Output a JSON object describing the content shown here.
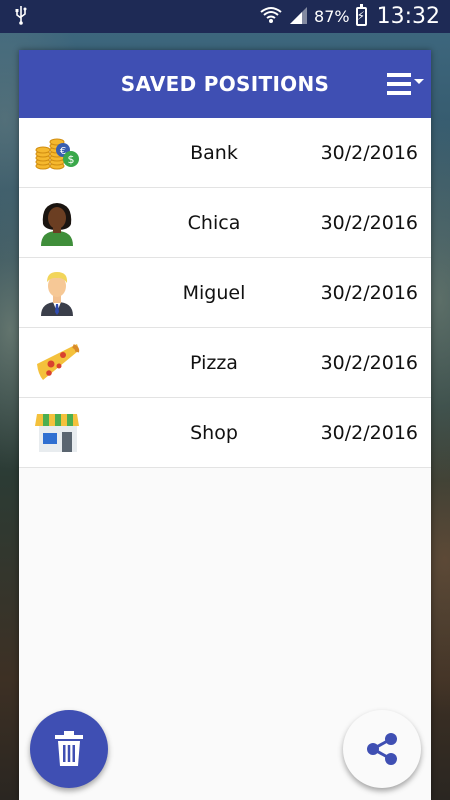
{
  "status_bar": {
    "battery_percent": "87%",
    "time": "13:32"
  },
  "header": {
    "title": "SAVED POSITIONS"
  },
  "positions": [
    {
      "name": "Bank",
      "date": "30/2/2016",
      "icon": "money-coins-icon"
    },
    {
      "name": "Chica",
      "date": "30/2/2016",
      "icon": "woman-avatar-icon"
    },
    {
      "name": "Miguel",
      "date": "30/2/2016",
      "icon": "man-avatar-icon"
    },
    {
      "name": "Pizza",
      "date": "30/2/2016",
      "icon": "pizza-slice-icon"
    },
    {
      "name": "Shop",
      "date": "30/2/2016",
      "icon": "shop-storefront-icon"
    }
  ],
  "colors": {
    "primary": "#3f4fb3",
    "status_bar": "#1e2a55",
    "card_bg": "#fafafa"
  }
}
